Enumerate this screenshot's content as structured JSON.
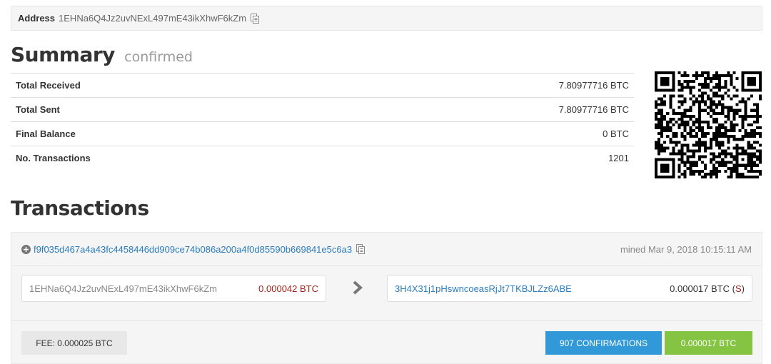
{
  "address": {
    "label": "Address",
    "value": "1EHNa6Q4Jz2uvNExL497mE43ikXhwF6kZm"
  },
  "summary": {
    "title": "Summary",
    "status": "confirmed",
    "rows": [
      {
        "label": "Total Received",
        "value": "7.80977716 BTC"
      },
      {
        "label": "Total Sent",
        "value": "7.80977716 BTC"
      },
      {
        "label": "Final Balance",
        "value": "0 BTC"
      },
      {
        "label": "No. Transactions",
        "value": "1201"
      }
    ]
  },
  "transactions": {
    "title": "Transactions",
    "items": [
      {
        "hash": "f9f035d467a4a43fc4458446dd909ce74b086a200a4f0d85590b669841e5c6a3",
        "mined": "mined Mar 9, 2018 10:15:11 AM",
        "input_address": "1EHNa6Q4Jz2uvNExL497mE43ikXhwF6kZm",
        "input_amount": "0.000042 BTC",
        "output_address": "3H4X31j1pHswncoeasRjJt7TKBJLZz6ABE",
        "output_amount": "0.000017 BTC",
        "output_flag_open": "(",
        "output_flag": "S",
        "output_flag_close": ")",
        "fee": "FEE: 0.000025 BTC",
        "confirmations": "907 CONFIRMATIONS",
        "total": "0.000017 BTC"
      }
    ]
  },
  "colors": {
    "link": "#2b7cbd",
    "negative": "#a1241b",
    "confirm_button": "#3199d7",
    "amount_button": "#84c442"
  }
}
